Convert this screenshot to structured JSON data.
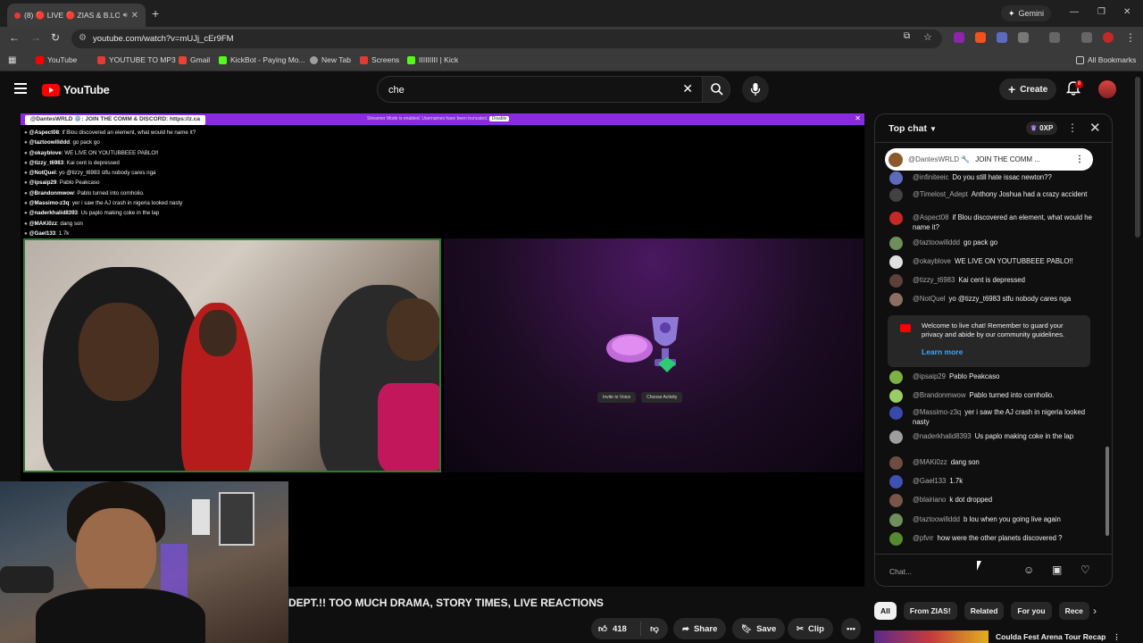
{
  "browser": {
    "tab_title": "(8) 🔴 LIVE 🔴 ZIAS & B.LOU",
    "new_tab": "+",
    "gemini_label": "Gemini",
    "url": "youtube.com/watch?v=mUJj_cEr9FM",
    "bookmarks": [
      {
        "label": "YouTube",
        "color": "#ff0000"
      },
      {
        "label": "YOUTUBE TO MP3",
        "color": "#e53935"
      },
      {
        "label": "Gmail",
        "color": "#ea4335"
      },
      {
        "label": "KickBot - Paying Mo...",
        "color": "#53fc18"
      },
      {
        "label": "New Tab",
        "color": "#9e9e9e"
      },
      {
        "label": "Screens",
        "color": "#e53935"
      },
      {
        "label": "IIIIIIIII | Kick",
        "color": "#53fc18"
      }
    ],
    "all_bookmarks": "All Bookmarks"
  },
  "youtube": {
    "logo_text": "YouTube",
    "search_value": "che",
    "create_label": "Create",
    "notif_count": "8"
  },
  "player": {
    "pinned_overlay": "@DantesWRLD ⚙️: JOIN THE COMM & DISCORD: https://z.ca",
    "streamer_mode": "Streamer Mode is enabled. Usernames have been truncated.",
    "disable_label": "Disable",
    "overlay_chat": [
      {
        "user": "@Aspect08",
        "text": "if Blou discovered an element, what would he name it?"
      },
      {
        "user": "@taztoowillddd",
        "text": "go pack go"
      },
      {
        "user": "@okayblove",
        "text": "WE LIVE ON YOUTUBBEEE PABLO!!"
      },
      {
        "user": "@tizzy_t6983",
        "text": "Kai cent is depressed"
      },
      {
        "user": "@NotQuel",
        "text": "yo @tizzy_t6983 stfu nobody cares nga"
      },
      {
        "user": "@ipsaip29",
        "text": "Pablo Peakcaso"
      },
      {
        "user": "@Brandonmwow",
        "text": "Pablo turned into cornholio."
      },
      {
        "user": "@Massimo-z3q",
        "text": "yer i saw the AJ crash in nigeria looked nasty"
      },
      {
        "user": "@naderkhalid8393",
        "text": "Us paplo making coke in the lap"
      },
      {
        "user": "@MAKi0zz",
        "text": "dang son"
      },
      {
        "user": "@Gael133",
        "text": "1.7k"
      },
      {
        "user": "@blairiano",
        "text": "k dot dropped"
      },
      {
        "user": "@taztoowillddd",
        "text": "b lou when you going live again"
      },
      {
        "user": "@pfvrr",
        "text": "how were the other planets discovered ?"
      }
    ],
    "invite_label": "Invite to Voice",
    "activity_label": "Choose Activity"
  },
  "video": {
    "title": "DEPT.!! TOO MUCH DRAMA, STORY TIMES, LIVE REACTIONS",
    "likes": "418",
    "share_label": "Share",
    "save_label": "Save",
    "clip_label": "Clip",
    "more_label": "•••"
  },
  "chat": {
    "mode": "Top chat",
    "xp": "0XP",
    "pinned": {
      "user": "@DantesWRLD 🔧",
      "text": "JOIN THE COMM ..."
    },
    "messages_before": [
      {
        "user": "@infiniteeic",
        "text": "Do you still hate issac newton??",
        "color": "#5c6bc0"
      },
      {
        "user": "@Timelost_Adept",
        "text": "Anthony Joshua had a crazy accident",
        "color": "#424242"
      },
      {
        "user": "@Aspect08",
        "text": "if Blou discovered an element, what would he name it?",
        "color": "#c62828"
      },
      {
        "user": "@taztoowillddd",
        "text": "go pack go",
        "color": "#6d8f5a"
      },
      {
        "user": "@okayblove",
        "text": "WE LIVE ON YOUTUBBEEE PABLO!!",
        "color": "#e0e0e0"
      },
      {
        "user": "@tizzy_t6983",
        "text": "Kai cent is depressed",
        "color": "#5d4037"
      },
      {
        "user": "@NotQuel",
        "text": "yo @tizzy_t6983 stfu nobody cares nga",
        "color": "#8d6e63"
      }
    ],
    "welcome": {
      "text": "Welcome to live chat! Remember to guard your privacy and abide by our community guidelines.",
      "learn_more": "Learn more"
    },
    "messages_after": [
      {
        "user": "@ipsaip29",
        "text": "Pablo Peakcaso",
        "color": "#7cb342"
      },
      {
        "user": "@Brandonmwow",
        "text": "Pablo turned into cornholio.",
        "color": "#9ccc65"
      },
      {
        "user": "@Massimo-z3q",
        "text": "yer i saw the AJ crash in nigeria looked nasty",
        "color": "#3949ab"
      },
      {
        "user": "@naderkhalid8393",
        "text": "Us paplo making coke in the lap",
        "color": "#9e9e9e"
      },
      {
        "user": "@MAKi0zz",
        "text": "dang son",
        "color": "#6d4c41"
      },
      {
        "user": "@Gael133",
        "text": "1.7k",
        "color": "#3f51b5"
      },
      {
        "user": "@blairiano",
        "text": "k dot dropped",
        "color": "#795548"
      },
      {
        "user": "@taztoowillddd",
        "text": "b lou when you going live again",
        "color": "#6d8f5a"
      },
      {
        "user": "@pfvrr",
        "text": "how were the other planets discovered ?",
        "color": "#558b2f"
      }
    ],
    "input_placeholder": "Chat..."
  },
  "chips": [
    "All",
    "From ZIAS!",
    "Related",
    "For you",
    "Rece"
  ],
  "related_title": "Coulda Fest Arena Tour Recap"
}
